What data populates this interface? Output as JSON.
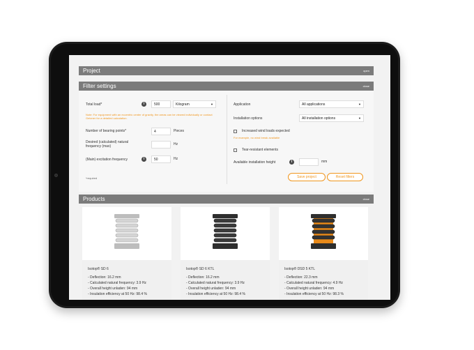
{
  "project": {
    "title": "Project",
    "action": "open"
  },
  "filter": {
    "title": "Filter settings",
    "action": "close",
    "total_load": {
      "label": "Total load*",
      "value": "500",
      "unit": "Kilogram"
    },
    "note": "Note: For equipment with an eccentric center of gravity, the areas can be viewed individually or contact Getzner for a detailed calculation.",
    "bearing_points": {
      "label": "Number of bearing points*",
      "value": "4",
      "unit": "Pieces"
    },
    "natural_frequency": {
      "label": "Desired (calculated) natural frequency (max)",
      "value": "",
      "unit": "Hz"
    },
    "excitation": {
      "label": "(Main) excitation frequency",
      "value": "50",
      "unit": "Hz"
    },
    "application": {
      "label": "Application",
      "value": "All applications"
    },
    "installation_options": {
      "label": "Installation options",
      "value": "All installation options"
    },
    "wind_loads": {
      "label": "Increased wind loads expected",
      "hint": "For example, no wind break available"
    },
    "tear_resistant": {
      "label": "Tear-resistant elements"
    },
    "installation_height": {
      "label": "Available installation height",
      "value": "",
      "unit": "mm"
    },
    "required_note": "*required",
    "save_label": "Save project",
    "reset_label": "Reset filters"
  },
  "products": {
    "title": "Products",
    "action": "close",
    "items": [
      {
        "name": "Isotop® SD 6",
        "color": "#d4d4d4",
        "specs": [
          "- Deflection: 16.2 mm",
          "- Calculated natural frequency: 3.9 Hz",
          "- Overall height unladen: 94 mm",
          "- Insulation efficiency at 50 Hz: 98.4 %"
        ]
      },
      {
        "name": "Isotop® SD 6 KTL",
        "color": "#3a3a3a",
        "specs": [
          "- Deflection: 16.2 mm",
          "- Calculated natural frequency: 3.9 Hz",
          "- Overall height unladen: 94 mm",
          "- Insulation efficiency at 50 Hz: 98.4 %"
        ]
      },
      {
        "name": "Isotop® DSD 5 KTL",
        "color": "#e88a1a",
        "specs": [
          "- Deflection: 22.3 mm",
          "- Calculated natural frequency: 4.9 Hz",
          "- Overall height unladen: 94 mm",
          "- Insulation efficiency at 50 Hz: 98.3 %"
        ]
      }
    ]
  }
}
